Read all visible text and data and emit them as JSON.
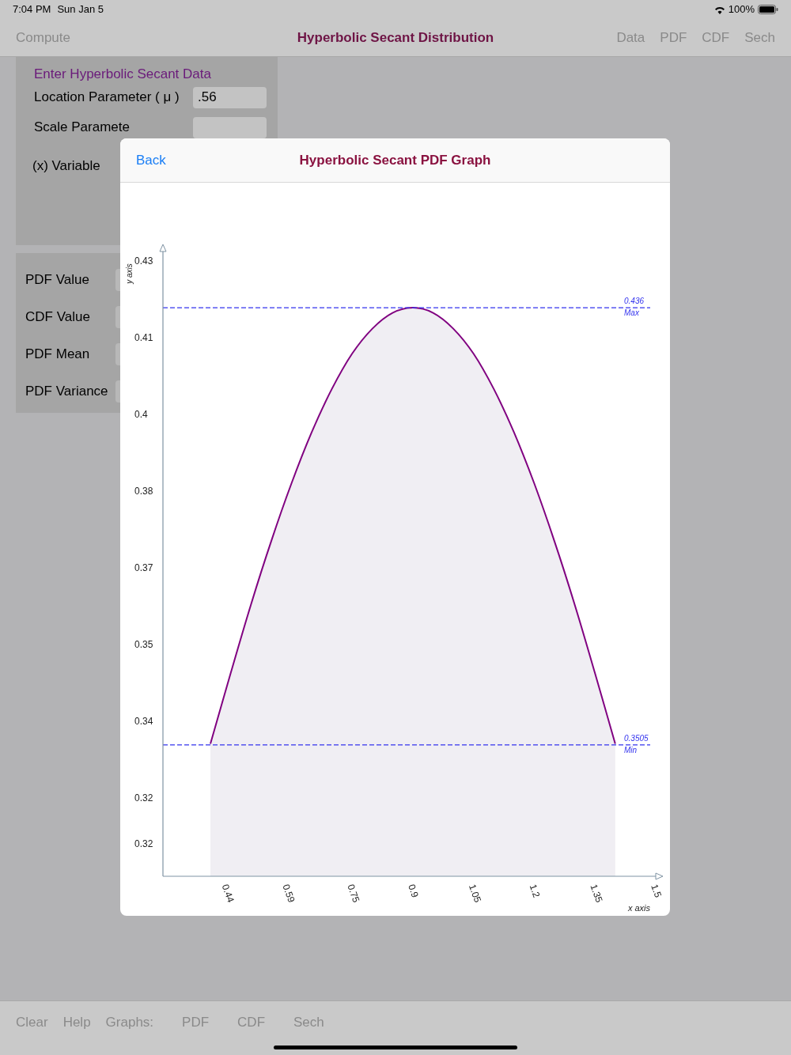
{
  "status_bar": {
    "time": "7:04 PM",
    "date": "Sun Jan 5",
    "battery": "100%"
  },
  "nav_bar": {
    "left_button": "Compute",
    "title": "Hyperbolic Secant Distribution",
    "right_buttons": [
      "Data",
      "PDF",
      "CDF",
      "Sech"
    ]
  },
  "data_panel": {
    "heading": "Enter Hyperbolic Secant Data",
    "fields": [
      {
        "label": "Location Parameter ( μ )",
        "value": ".56"
      },
      {
        "label": "Scale Paramete"
      },
      {
        "label": "(x) Variable"
      }
    ]
  },
  "results_panel": {
    "labels": [
      "PDF Value",
      "CDF Value",
      "PDF Mean",
      "PDF Variance"
    ]
  },
  "graph_dialog": {
    "back_button": "Back",
    "title": "Hyperbolic Secant PDF Graph",
    "chart_data": {
      "type": "area",
      "xlabel": "x axis",
      "ylabel": "y axis",
      "x": [
        0.4,
        0.45,
        0.5,
        0.55,
        0.6,
        0.65,
        0.7,
        0.75,
        0.8,
        0.85,
        0.9,
        0.95,
        1.0,
        1.05,
        1.1,
        1.15,
        1.2,
        1.25,
        1.3,
        1.35,
        1.4
      ],
      "series": [
        {
          "color": "#800080",
          "values": [
            0.3356,
            0.3494,
            0.3628,
            0.3752,
            0.3865,
            0.3965,
            0.405,
            0.4119,
            0.4168,
            0.4199,
            0.4209,
            0.4199,
            0.4168,
            0.4119,
            0.405,
            0.3965,
            0.3865,
            0.3752,
            0.3628,
            0.3494,
            0.3356
          ]
        }
      ],
      "xlim": [
        0.2828,
        1.5
      ],
      "ylim": [
        0.3097,
        0.4319
      ],
      "xticks": [
        0.44,
        0.59,
        0.75,
        0.9,
        1.05,
        1.2,
        1.35,
        1.5
      ],
      "yticks": [
        0.43,
        {
          "value": 0.415,
          "label": "0.41"
        },
        0.4,
        {
          "value": 0.385,
          "label": "0.38"
        },
        0.37,
        {
          "value": 0.355,
          "label": "0.35"
        },
        0.34,
        {
          "value": 0.325,
          "label": "0.32"
        },
        {
          "value": 0.316,
          "label": "0.32"
        }
      ],
      "ref_lines": [
        {
          "axis": "y",
          "value": 0.4209
        },
        {
          "axis": "y",
          "value": 0.3354
        }
      ],
      "annotations": [
        "0.436",
        "Max",
        "0.3505",
        "Min"
      ]
    }
  },
  "toolbar": {
    "items": [
      "Clear",
      "Help",
      "Graphs:",
      "PDF",
      "CDF",
      "Sech"
    ]
  }
}
